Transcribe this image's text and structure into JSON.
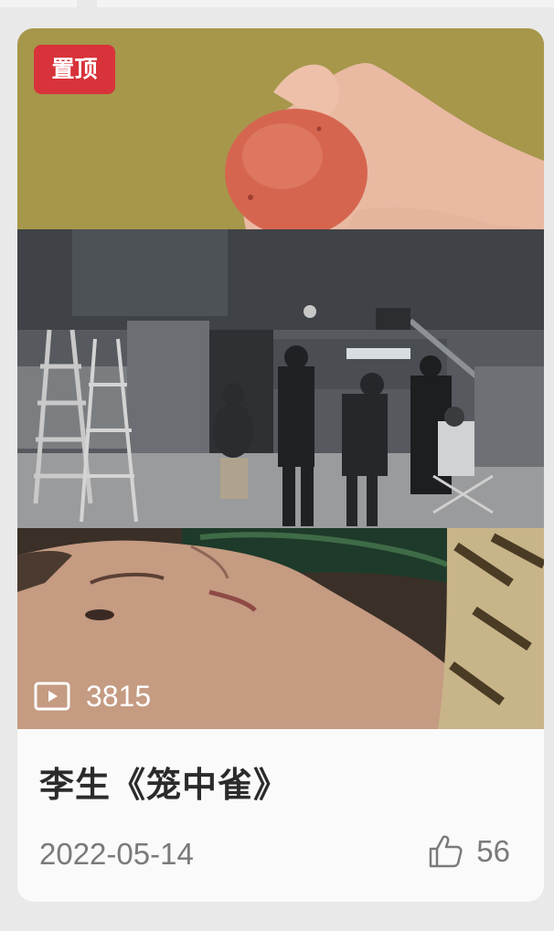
{
  "card": {
    "pin_label": "置顶",
    "views": "3815",
    "title": "李生《笼中雀》",
    "date": "2022-05-14",
    "likes": "56"
  },
  "icons": {
    "views": "play-video-icon",
    "likes": "thumbs-up-icon"
  },
  "colors": {
    "pin_badge": "#d8333a",
    "page_background": "#e9e9e9",
    "card_background": "#fafafa"
  }
}
